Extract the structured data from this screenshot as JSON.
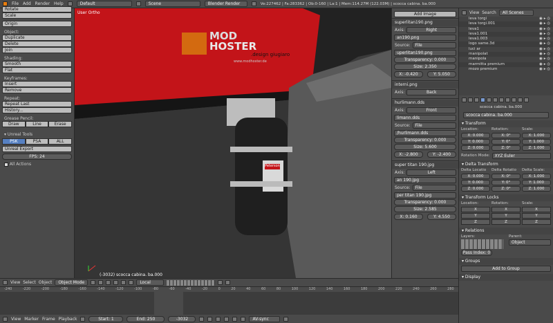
{
  "menu": {
    "file": "File",
    "add": "Add",
    "render": "Render",
    "help": "Help"
  },
  "header": {
    "layout": "Default",
    "scene": "Scene",
    "engine": "Blender Render",
    "stats": "Ve:227462 | Fa:283362 | Ob:0-160 | La:1 | Mem:114.27M (122.03M) | scocca cabina. ba.000"
  },
  "toolshelf": {
    "top_buttons": [
      "Rotate",
      "Scale"
    ],
    "origin": "Origin",
    "object_label": "Object:",
    "object_buttons": [
      "Duplicate",
      "Delete",
      "Join"
    ],
    "shading_label": "Shading:",
    "shading_buttons": [
      "Smooth",
      "Flat"
    ],
    "keyframes_label": "Keyframes:",
    "keyframe_buttons": [
      "Insert",
      "Remove"
    ],
    "repeat_label": "Repeat:",
    "repeat_buttons": [
      "Repeat Last",
      "History..."
    ],
    "grease_label": "Grease Pencil:",
    "grease_buttons": [
      "Draw",
      "Line",
      "Erase"
    ],
    "unreal_label": "Unreal Tools",
    "unreal_tabs": [
      "PSK",
      "PSA",
      "ALL"
    ],
    "unreal_export": "Unreal Export",
    "fps": "FPS: 24",
    "all_actions": "All Actions"
  },
  "viewport": {
    "label": "User Ortho",
    "logo_top": "MOD",
    "logo_bottom": "HOSTER",
    "logo_sub": ".design giugiaro",
    "site": "www.modhoster.de",
    "extinguisher": "Peterson",
    "info": "(-3032) scocca cabina. ba.000"
  },
  "propcol": {
    "add_image": "Add Image",
    "panels": [
      {
        "title": "superlitan190.png",
        "axis": "Right",
        "file_field": "an190.png",
        "source": "File",
        "image": "uperlitan190.png",
        "transparency": "Transparency: 0.000",
        "size": "Size: 2.350",
        "x": "X: -0.420",
        "y": "Y: 5.050"
      },
      {
        "title": "interni.png",
        "axis": "Back"
      },
      {
        "title": "hurlimann.dds",
        "axis": "Front",
        "file_field": "limann.dds",
        "source": "File",
        "image": "/hurlimann.dds",
        "transparency": "Transparency: 0.000",
        "size": "Size: 5.600",
        "x": "X: -2.800",
        "y": "Y: -2.400"
      },
      {
        "title": "super titan 190.jpg",
        "axis": "Left",
        "file_field": "an 190.jpg",
        "source": "File",
        "image": "per titan 190.jpg",
        "transparency": "Transparency: 0.000",
        "size": "Size: 2.585",
        "x": "X: 0.160",
        "y": "Y: 4.550"
      }
    ]
  },
  "outliner": {
    "view": "View",
    "search": "Search",
    "scene_filter": "All Scenes",
    "items": [
      "leva torgi",
      "leva torgi.001",
      "leva1",
      "leva1.001",
      "leva1.003",
      "logo same.3d",
      "luci ar",
      "manipolat",
      "manipola",
      "marmitta premium",
      "mozo premium"
    ]
  },
  "props": {
    "object_name": "scocca cabina. ba.000",
    "object_field": "scocca cabina. ba.000",
    "transform": "Transform",
    "location": "Location:",
    "rotation": "Rotation:",
    "scale": "Scale:",
    "loc": [
      "X: 0.000",
      "Y: 0.000",
      "Z: 0.000"
    ],
    "rot": [
      "X: 0°",
      "Y: 0°",
      "Z: 0°"
    ],
    "scl": [
      "X: 1.000",
      "Y: 1.000",
      "Z: 1.000"
    ],
    "rotation_mode_label": "Rotation Mode:",
    "rotation_mode": "XYZ Euler",
    "delta": "Delta Transform",
    "dloc": "Delta Locatio",
    "drot": "Delta Rotatio",
    "dscl": "Delta Scale:",
    "dlocv": [
      "X: 0.000",
      "Y: 0.000",
      "Z: 0.000"
    ],
    "drotv": [
      "X: 0°",
      "Y: 0°",
      "Z: 0°"
    ],
    "dsclv": [
      "X: 1.000",
      "Y: 1.000",
      "Z: 1.000"
    ],
    "locks": "Transform Locks",
    "lockaxes": [
      "X",
      "Y",
      "Z"
    ],
    "relations": "Relations",
    "layers": "Layers:",
    "parent": "Parent:",
    "parent_value": "Object",
    "pass_index": "Pass Index: 0",
    "groups": "Groups",
    "add_to_group": "Add to Group",
    "display": "Display"
  },
  "viewhdr": {
    "view": "View",
    "select": "Select",
    "object": "Object",
    "mode": "Object Mode",
    "orientation": "Local"
  },
  "timeline": {
    "ticks": [
      "-240",
      "-220",
      "-200",
      "-180",
      "-160",
      "-140",
      "-120",
      "-100",
      "-80",
      "-60",
      "-40",
      "-20",
      "0",
      "20",
      "40",
      "60",
      "80",
      "100",
      "120",
      "140",
      "160",
      "180",
      "200",
      "220",
      "240",
      "260",
      "280"
    ],
    "view": "View",
    "marker": "Marker",
    "frame": "Frame",
    "playback": "Playback",
    "start": "Start: 1",
    "end": "End: 250",
    "current": "-3032",
    "sync": "AV-sync"
  }
}
